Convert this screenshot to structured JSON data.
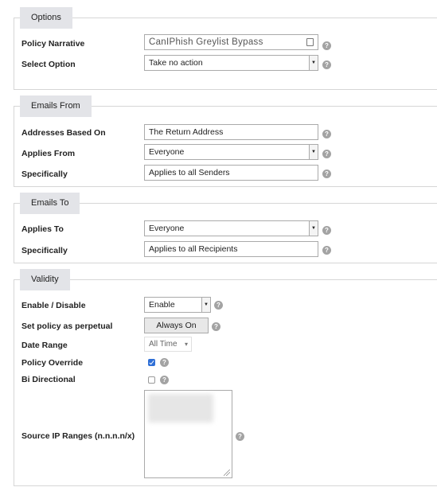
{
  "options": {
    "legend": "Options",
    "policy_narrative_label": "Policy Narrative",
    "policy_narrative_value": "CanIPhish Greylist Bypass",
    "select_option_label": "Select Option",
    "select_option_value": "Take no action"
  },
  "emails_from": {
    "legend": "Emails From",
    "addresses_label": "Addresses Based On",
    "addresses_value": "The Return Address",
    "applies_from_label": "Applies From",
    "applies_from_value": "Everyone",
    "specifically_label": "Specifically",
    "specifically_value": "Applies to all Senders"
  },
  "emails_to": {
    "legend": "Emails To",
    "applies_to_label": "Applies To",
    "applies_to_value": "Everyone",
    "specifically_label": "Specifically",
    "specifically_value": "Applies to all Recipients"
  },
  "validity": {
    "legend": "Validity",
    "enable_label": "Enable / Disable",
    "enable_value": "Enable",
    "perpetual_label": "Set policy as perpetual",
    "perpetual_button": "Always On",
    "date_range_label": "Date Range",
    "date_range_value": "All Time",
    "override_label": "Policy Override",
    "override_checked": true,
    "bidirectional_label": "Bi Directional",
    "bidirectional_checked": false,
    "source_ip_label": "Source IP Ranges (n.n.n.n/x)"
  },
  "icons": {
    "help": "?",
    "select_arrow": "▼",
    "caret": "▾"
  },
  "colors": {
    "legend_bg": "#e3e4e8",
    "checkbox_checked": "#2f6fd6",
    "help_icon": "#a3a3a3"
  }
}
